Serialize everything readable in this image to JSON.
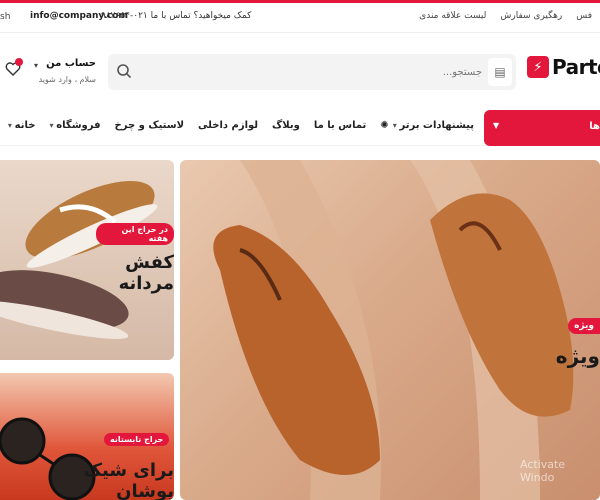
{
  "topbar": {
    "lang": "sh",
    "email": "info@company.com",
    "phone": "۰۲۱-۹۸۷۶۵۴",
    "help_text": "کمک میخواهید؟ تماس با ما",
    "links": [
      "رهگیری سفارش",
      "لیست علاقه مندی"
    ],
    "left_edge_label": "فس"
  },
  "brand": {
    "logo_text": "Parto",
    "accent_color": "#e3173b"
  },
  "search": {
    "placeholder": "جستجو..."
  },
  "account": {
    "title": "حساب من",
    "subtitle": "سلام ، وارد شوید"
  },
  "nav": {
    "categories_label": "ها",
    "items": [
      {
        "label": "خانه",
        "caret": true
      },
      {
        "label": "فروشگاه",
        "caret": true
      },
      {
        "label": "لاستیک و چرخ",
        "caret": false
      },
      {
        "label": "لوازم داخلی",
        "caret": false
      },
      {
        "label": "وبلاگ",
        "caret": false
      },
      {
        "label": "تماس با ما",
        "caret": false
      },
      {
        "label": "پیشنهادات برتر",
        "caret": true
      }
    ]
  },
  "banners": [
    {
      "badge": "در حراج این هفته",
      "title": "کفش مردانه"
    },
    {
      "badge": "حراج تابستانه",
      "title": "برای شیک پوشان"
    }
  ],
  "hero": {
    "badge": "ویژه",
    "title": "ویژه",
    "title_fragment": "ویژه"
  },
  "watermark": "Activate Windo"
}
